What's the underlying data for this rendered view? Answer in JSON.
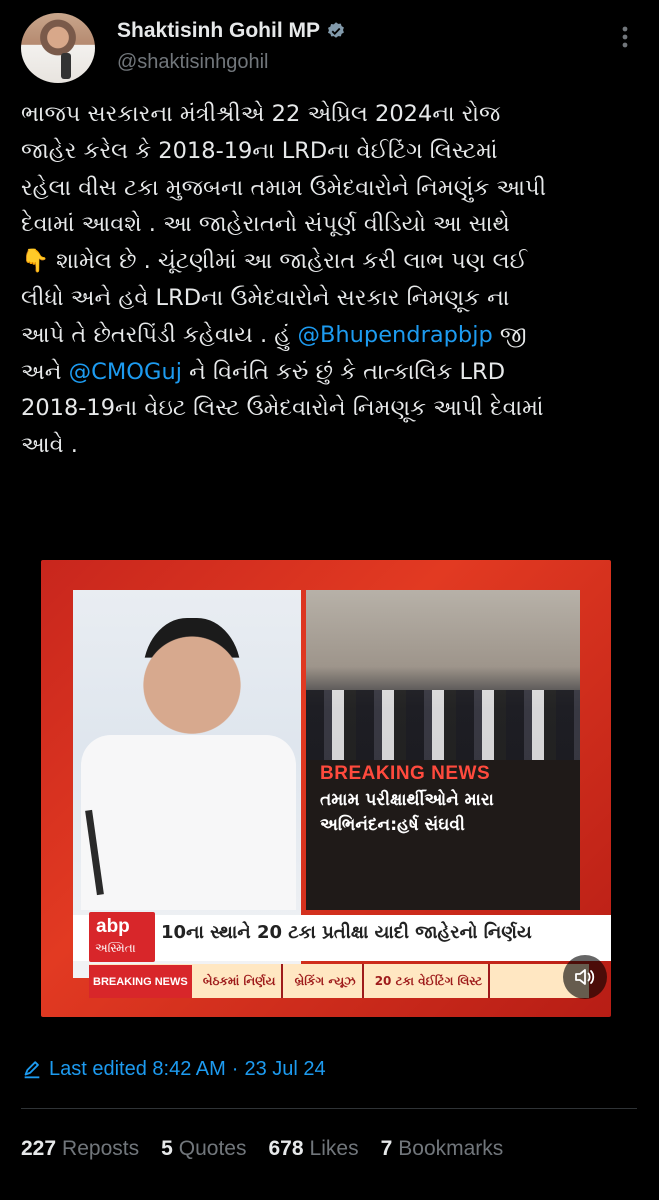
{
  "author": {
    "display_name": "Shaktisinh Gohil MP",
    "handle": "@shaktisinhgohil",
    "verified": true,
    "avatar_icon": "profile-photo"
  },
  "icons": {
    "more": "more-vertical-icon",
    "verified": "verified-badge-icon",
    "edit": "pencil-icon",
    "sound": "speaker-muted-icon"
  },
  "tweet": {
    "lines": [
      "ભાજપ સરકારના મંત્રીશ્રીએ 22 એપ્રિલ 2024ના રોજ",
      "જાહેર કરેલ કે 2018-19ના LRDના વેઈટિંગ લિસ્ટમાં",
      "રહેલા વીસ ટકા મુજબના તમામ ઉમેદવારોને નિમણુંક આપી",
      "દેવામાં આવશે . આ જાહેરાતનો સંપૂર્ણ વીડિયો આ સાથે",
      "👇 શામેલ છે .  ચૂંટણીમાં આ જાહેરાત કરી લાભ પણ લઈ",
      "લીધો અને હવે LRDના ઉમેદવારોને સરકાર નિમણૂક  ના",
      "આપે તે છેતરપિંડી કહેવાય . હું",
      "જી",
      "અને",
      "ને વિનંતિ કરું છું કે તાત્કાલિક LRD",
      "2018-19ના વેઇટ લિસ્ટ ઉમેદવારોને નિમણૂક આપી દેવામાં",
      "આવે ."
    ],
    "mention_1": "@Bhupendrapbjp",
    "mention_2": "@CMOGuj"
  },
  "media": {
    "breaking_label": "BREAKING NEWS",
    "breaking_headline": "તમામ પરીક્ષાર્થીઓને મારા અભિનંદન:હર્ષ સંઘવી",
    "channel_logo": "abp",
    "channel_sub": "અસ્મિતા",
    "lower_headline": "10ના સ્થાને 20 ટકા પ્રતીક્ષા યાદી જાહેરનો નિર્ણય",
    "ticker_label": "BREAKING NEWS",
    "ticker_items": [
      "બેઠકમાં નિર્ણય",
      "બ્રેકિંગ ન્યૂઝ",
      "20 ટકા વેઈટિંગ લિસ્ટ"
    ]
  },
  "edited": {
    "label": "Last edited 8:42 AM",
    "separator": "·",
    "date": "23 Jul 24"
  },
  "stats": [
    {
      "count": "227",
      "label": "Reposts"
    },
    {
      "count": "5",
      "label": "Quotes"
    },
    {
      "count": "678",
      "label": "Likes"
    },
    {
      "count": "7",
      "label": "Bookmarks"
    }
  ],
  "colors": {
    "background": "#000000",
    "text": "#e7e9ea",
    "muted": "#71767b",
    "link": "#1d9bf0",
    "divider": "#2f3336"
  }
}
